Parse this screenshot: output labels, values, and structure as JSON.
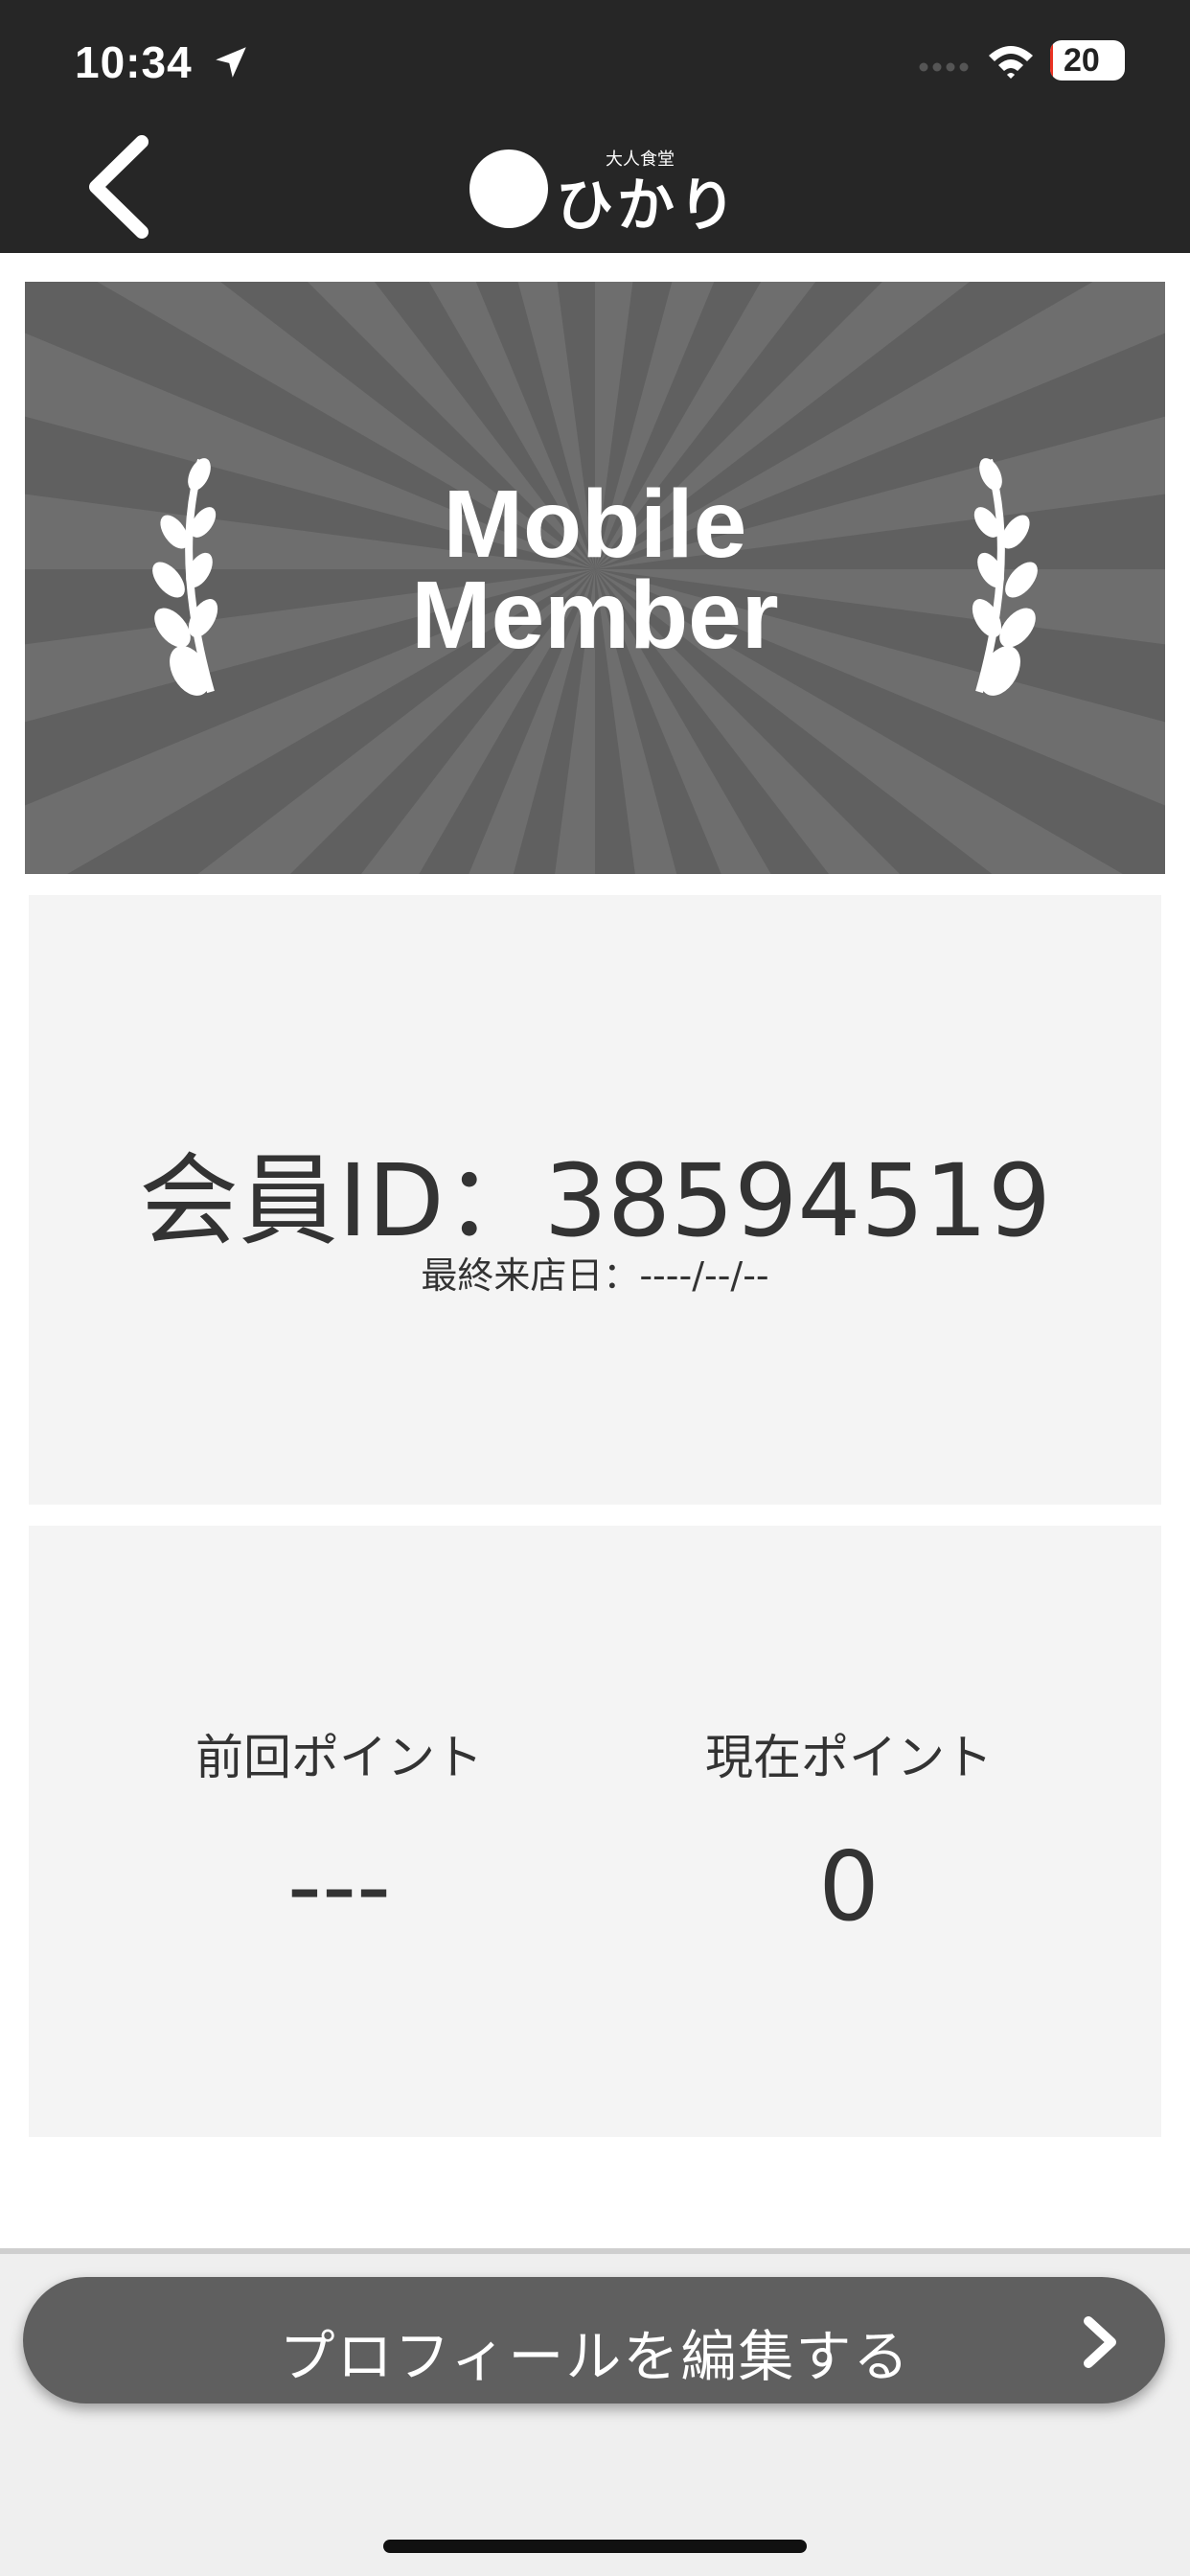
{
  "status_bar": {
    "time": "10:34",
    "battery": "20",
    "battery_level": 0.2,
    "icons": [
      "location-arrow-icon",
      "cellular-signal-icon",
      "wifi-icon",
      "battery-icon"
    ]
  },
  "nav": {
    "back_icon": "chevron-left-icon",
    "logo_text": "ひかり",
    "logo_subtitle": "大人食堂"
  },
  "banner": {
    "title_line1": "Mobile",
    "title_line2": "Member",
    "icons": [
      "laurel-left-icon",
      "laurel-right-icon"
    ],
    "colors": {
      "ray_dark": "#5e5e5e",
      "ray_light": "#6e6e6e"
    }
  },
  "member": {
    "id_text": "会員ID：38594519",
    "last_visit": "最終来店日：----/--/--"
  },
  "points": {
    "previous_label": "前回ポイント",
    "previous_value": "---",
    "current_label": "現在ポイント",
    "current_value": "0"
  },
  "actions": {
    "edit_profile_label": "プロフィールを編集する",
    "edit_icon": "chevron-right-icon"
  },
  "colors": {
    "topbar": "#262626",
    "button": "#5f5f5f",
    "card": "#f4f4f4",
    "battery_low": "#ea3323"
  }
}
